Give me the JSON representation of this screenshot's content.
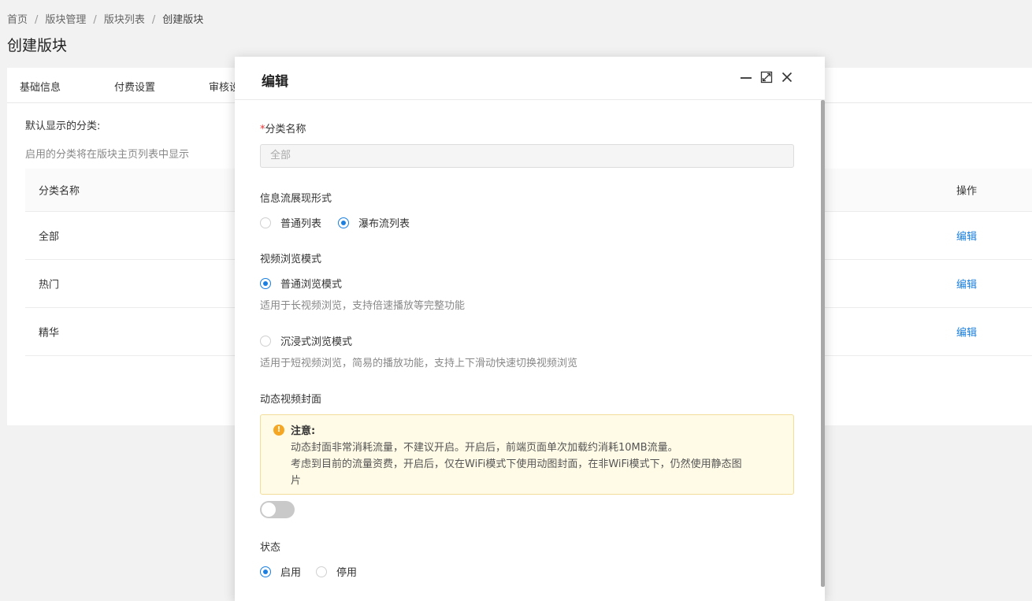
{
  "breadcrumb": [
    "首页",
    "版块管理",
    "版块列表",
    "创建版块"
  ],
  "page_title": "创建版块",
  "tabs": [
    "基础信息",
    "付费设置",
    "审核设"
  ],
  "section": {
    "label": "默认显示的分类:",
    "hint": "启用的分类将在版块主页列表中显示"
  },
  "table": {
    "headers": {
      "name": "分类名称",
      "op": "操作"
    },
    "rows": [
      {
        "name": "全部",
        "op": "编辑"
      },
      {
        "name": "热门",
        "op": "编辑"
      },
      {
        "name": "精华",
        "op": "编辑"
      }
    ]
  },
  "modal": {
    "title": "编辑",
    "icons": [
      "minimize-icon",
      "maximize-icon",
      "close-icon"
    ],
    "category_name": {
      "required_mark": "*",
      "label": "分类名称",
      "placeholder": "全部"
    },
    "feed_style": {
      "label": "信息流展现形式",
      "options": [
        "普通列表",
        "瀑布流列表"
      ],
      "selected": "瀑布流列表"
    },
    "video_mode": {
      "label": "视频浏览模式",
      "options": [
        {
          "label": "普通浏览模式",
          "desc": "适用于长视频浏览，支持倍速播放等完整功能"
        },
        {
          "label": "沉浸式浏览模式",
          "desc": "适用于短视频浏览，简易的播放功能，支持上下滑动快速切换视频浏览"
        }
      ],
      "selected": "普通浏览模式"
    },
    "dynamic_cover": {
      "label": "动态视频封面",
      "notice_title": "注意:",
      "notice_lines": [
        "动态封面非常消耗流量，不建议开启。开启后，前端页面单次加载约消耗10MB流量。",
        "考虑到目前的流量资费，开启后，仅在WiFi模式下使用动图封面，在非WiFi模式下，仍然使用静态图",
        "片"
      ],
      "enabled": false
    },
    "status": {
      "label": "状态",
      "options": [
        "启用",
        "停用"
      ],
      "selected": "启用"
    }
  },
  "colors": {
    "accent": "#1a7fe0",
    "warning": "#f5a623",
    "notice_bg": "#fffbe6"
  }
}
